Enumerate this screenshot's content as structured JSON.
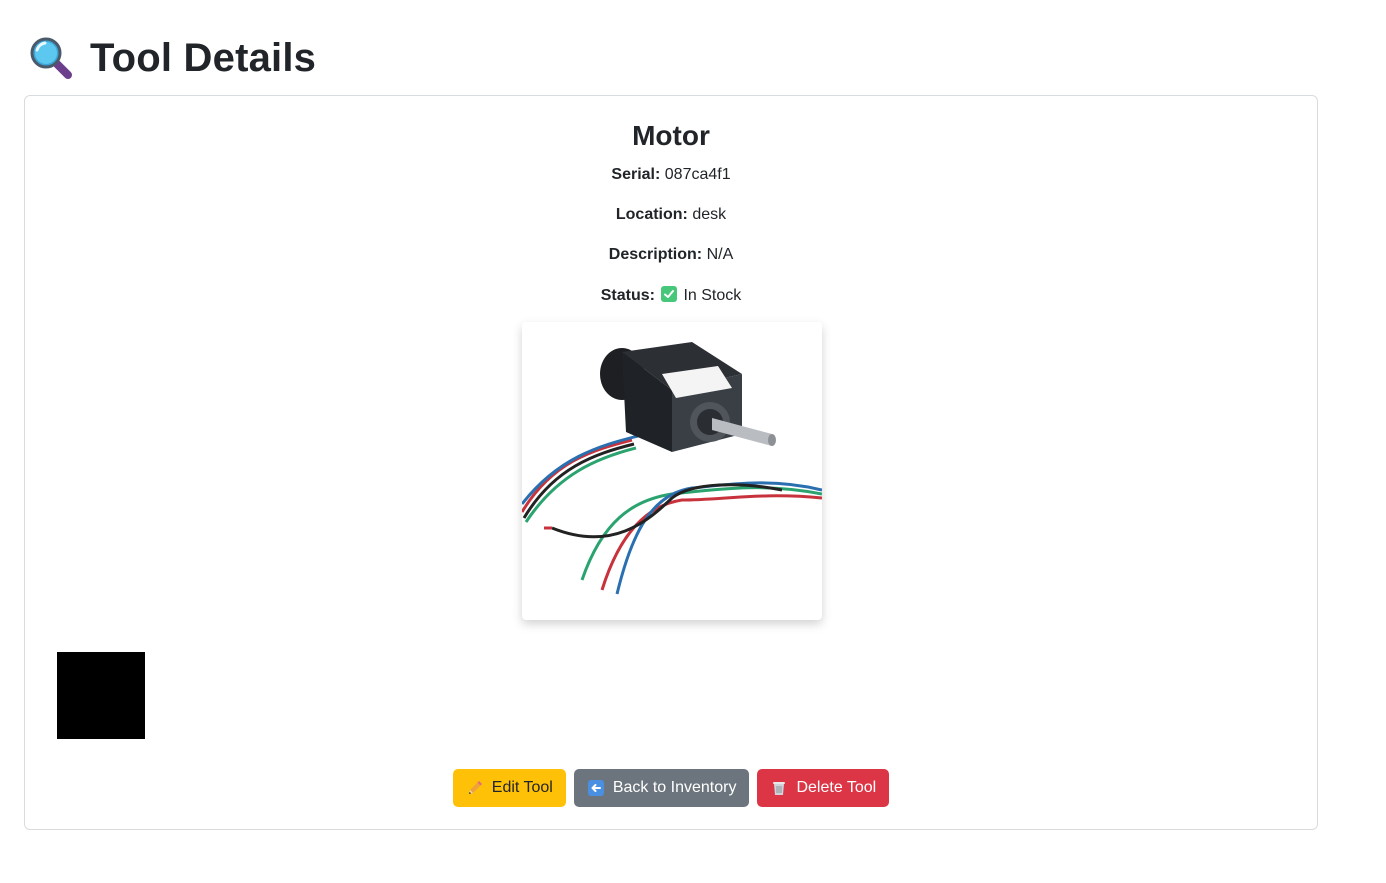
{
  "page": {
    "title": "Tool Details",
    "title_icon": "magnifying-glass-icon"
  },
  "tool": {
    "name": "Motor",
    "serial_label": "Serial:",
    "serial": "087ca4f1",
    "location_label": "Location:",
    "location": "desk",
    "description_label": "Description:",
    "description": "N/A",
    "status_label": "Status:",
    "status": "In Stock",
    "status_icon": "check-mark-icon",
    "image_icon": "stepper-motor-photo"
  },
  "actions": {
    "edit_label": "Edit Tool",
    "edit_icon": "pencil-icon",
    "back_label": "Back to Inventory",
    "back_icon": "left-arrow-icon",
    "delete_label": "Delete Tool",
    "delete_icon": "wastebasket-icon"
  },
  "colors": {
    "edit": "#ffc107",
    "back": "#6c757d",
    "delete": "#dc3545",
    "status_check": "#47c779"
  }
}
